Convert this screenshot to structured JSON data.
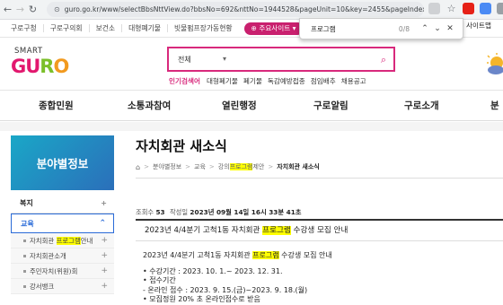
{
  "browser": {
    "url": "guro.go.kr/www/selectBbsNttView.do?bbsNo=692&nttNo=1944528&pageUnit=10&key=2455&pageIndex=1"
  },
  "find_bar": {
    "query": "프로그램",
    "count": "0/8"
  },
  "util_bar": {
    "links": [
      "구로구청",
      "구로구의회",
      "보건소",
      "대형폐기물",
      "빗물펌프장가동현황"
    ],
    "main_sites_label": "주요사이트",
    "sitemap_label": "사이트맵"
  },
  "header": {
    "logo_top": "SMART",
    "logo_main": "GURO",
    "search_select": "전체",
    "popular_title": "인기검색어",
    "popular_keywords": [
      "대형폐기물",
      "폐기물",
      "독감예방접종",
      "점임배추",
      "채용공고"
    ]
  },
  "gnb": {
    "items": [
      "종합민원",
      "소통과참여",
      "열린행정",
      "구로알림",
      "구로소개",
      "분"
    ]
  },
  "sidebar": {
    "title": "분야별정보",
    "items": [
      {
        "label": "복지",
        "sign": "+"
      },
      {
        "label": "교육",
        "sign": "^"
      }
    ],
    "subitems": [
      {
        "pre": "자치회관 ",
        "hl": "프로그램",
        "post": "안내"
      },
      {
        "pre": "자치회관소개",
        "hl": "",
        "post": ""
      },
      {
        "pre": "주민자치(위원)회",
        "hl": "",
        "post": ""
      },
      {
        "pre": "강서뱅크",
        "hl": "",
        "post": ""
      }
    ]
  },
  "content": {
    "title": "자치회관 새소식",
    "breadcrumb": {
      "a": "분야별정보",
      "b": "교육",
      "c_pre": "강의",
      "c_hl": "프로그램",
      "c_post": "제안",
      "current": "자치회관 새소식"
    },
    "meta": {
      "views_label": "조회수",
      "views": "53",
      "date_label": "작성일",
      "date": "2023년 09월 14일 16시 33분 41초"
    },
    "post_title": {
      "pre": "2023년 4/4분기 고척1동 자치회관 ",
      "hl": "프로그램",
      "post": " 수강생 모집 안내"
    },
    "body": {
      "intro_pre": "2023년 4/4분기 고척1동 자치회관 ",
      "intro_hl": "프로그램",
      "intro_post": " 수강생 모집 안내",
      "l1": "• 수강기간 : 2023. 10. 1.~ 2023. 12. 31.",
      "l2": "• 접수기간",
      "l3": "- 온라인 접수 : 2023. 9. 15.(금)~2023. 9. 18.(월)",
      "l4": "• 모집정원 20% 초 온라인접수로 받음"
    }
  },
  "colors": {
    "brand_pink": "#d8297c",
    "find_highlight": "#ffff00",
    "sidebar_blue": "#2b6fba"
  }
}
